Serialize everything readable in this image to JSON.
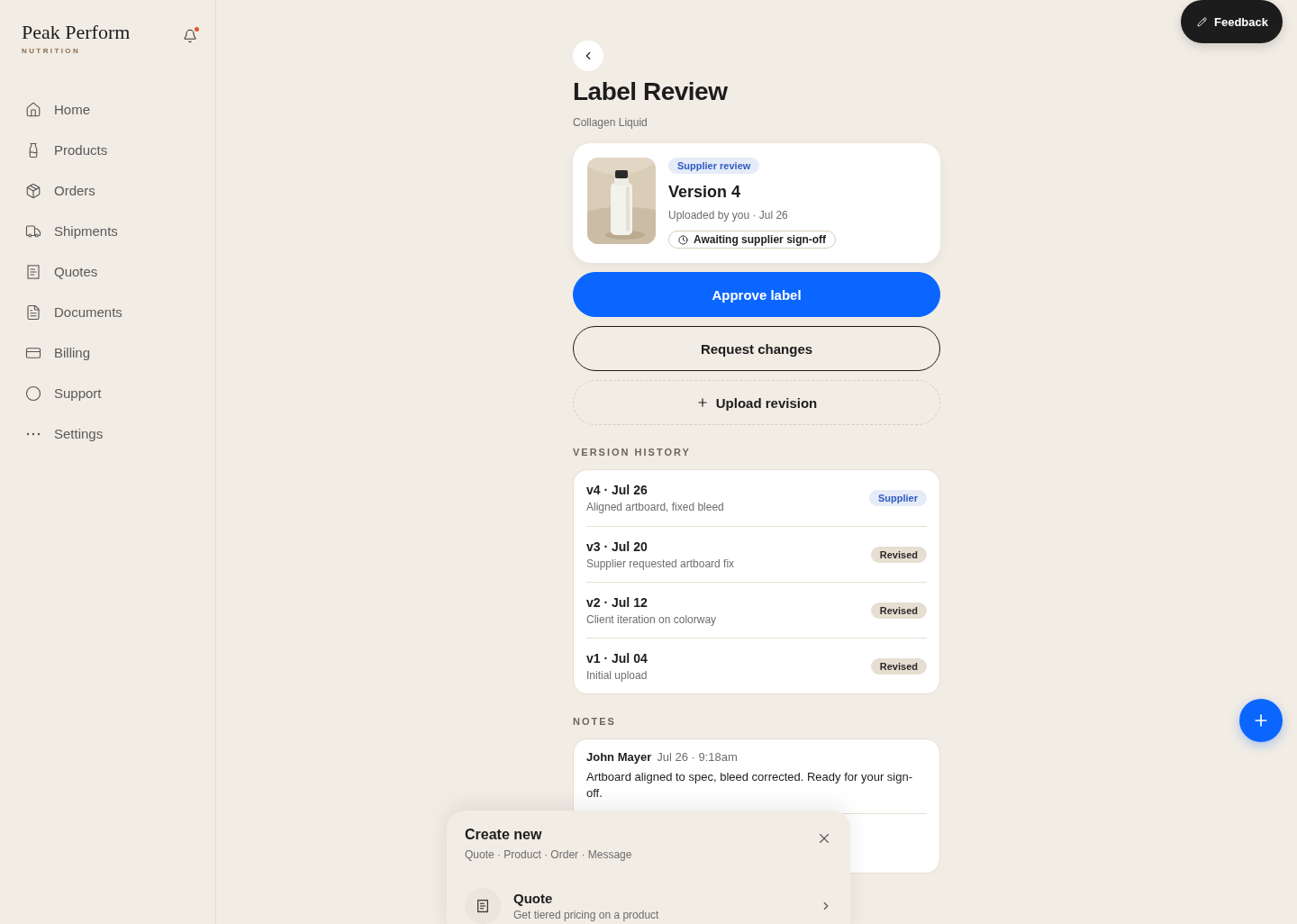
{
  "brand": {
    "name": "Peak Perform",
    "tagline": "NUTRITION",
    "notifications": true
  },
  "nav": [
    {
      "label": "Home",
      "kind": "home"
    },
    {
      "label": "Products",
      "kind": "bottle"
    },
    {
      "label": "Orders",
      "kind": "box"
    },
    {
      "label": "Shipments",
      "kind": "truck"
    },
    {
      "label": "Quotes",
      "kind": "quote"
    },
    {
      "label": "Documents",
      "kind": "document"
    },
    {
      "label": "Billing",
      "kind": "card"
    },
    {
      "label": "Support",
      "kind": "circle"
    },
    {
      "label": "Settings",
      "kind": "dots"
    }
  ],
  "feedback": {
    "label": "Feedback"
  },
  "page": {
    "title": "Label Review",
    "subtitle": "Collagen Liquid"
  },
  "version_card": {
    "tag": "Supplier review",
    "title": "Version 4",
    "meta": "Uploaded by you · Jul 26",
    "status": "Awaiting supplier sign-off"
  },
  "actions": [
    {
      "label": "Approve label",
      "kind": "primary"
    },
    {
      "label": "Request changes",
      "kind": "outline"
    },
    {
      "label": "Upload revision",
      "kind": "dashed"
    }
  ],
  "history": {
    "heading": "VERSION HISTORY",
    "rows": [
      {
        "title": "v4 · Jul 26",
        "note": "Aligned artboard, fixed bleed",
        "tag": "Supplier",
        "kind": "supplier"
      },
      {
        "title": "v3 · Jul 20",
        "note": "Supplier requested artboard fix",
        "tag": "Revised",
        "kind": "revised"
      },
      {
        "title": "v2 · Jul 12",
        "note": "Client iteration on colorway",
        "tag": "Revised",
        "kind": "revised"
      },
      {
        "title": "v1 · Jul 04",
        "note": "Initial upload",
        "tag": "Revised",
        "kind": "revised"
      }
    ]
  },
  "notes": {
    "heading": "NOTES",
    "items": [
      {
        "author": "John Mayer",
        "time": "Jul 26 · 9:18am",
        "text": "Artboard aligned to spec, bleed corrected. Ready for your sign-off."
      }
    ]
  },
  "sheet": {
    "title": "Create new",
    "subtitle": "Quote · Product · Order · Message",
    "items": [
      {
        "title": "Quote",
        "description": "Get tiered pricing on a product",
        "kind": "quote"
      }
    ]
  }
}
